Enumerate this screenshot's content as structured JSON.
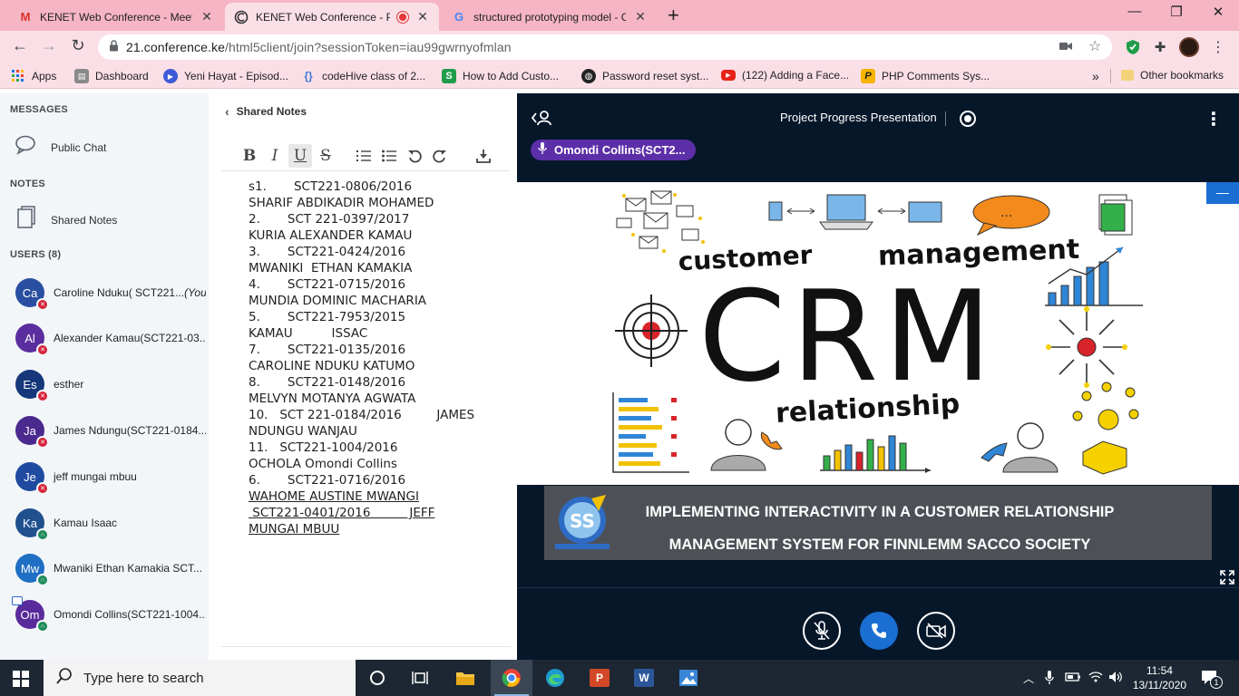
{
  "browser": {
    "tabs": [
      {
        "title": "KENET Web Conference - Meetin",
        "icon": "gmail-icon",
        "active": false
      },
      {
        "title": "KENET Web Conference - Pro",
        "icon": "conference-icon",
        "active": true
      },
      {
        "title": "structured prototyping model - C",
        "icon": "google-icon",
        "active": false
      }
    ],
    "new_tab": "+",
    "window_controls": {
      "minimize": "—",
      "restore": "❐",
      "close": "✕"
    },
    "url_host": "21.conference.ke",
    "url_path": "/html5client/join?sessionToken=iau99gwrnyofmlan",
    "bookmarks": [
      {
        "label": "Apps",
        "icon": "apps-grid-icon"
      },
      {
        "label": "Dashboard",
        "icon": "dashboard-icon"
      },
      {
        "label": "Yeni Hayat - Episod...",
        "icon": "video-icon"
      },
      {
        "label": "codeHive class of 2...",
        "icon": "codehive-icon"
      },
      {
        "label": "How to Add Custo...",
        "icon": "s-app-icon"
      },
      {
        "label": "Password reset syst...",
        "icon": "globe-icon"
      },
      {
        "label": "(122) Adding a Face...",
        "icon": "youtube-icon"
      },
      {
        "label": "PHP Comments Sys...",
        "icon": "p-app-icon"
      }
    ],
    "bookmarks_more": "»",
    "other_bookmarks": "Other bookmarks"
  },
  "sidebar": {
    "messages_label": "MESSAGES",
    "public_chat": "Public Chat",
    "notes_label": "NOTES",
    "shared_notes": "Shared Notes",
    "users_label": "USERS (8)",
    "users": [
      {
        "initials": "Ca",
        "name": "Caroline Nduku( SCT221...",
        "you": "(You)",
        "color": "#2a4fa0",
        "status": "muted"
      },
      {
        "initials": "Al",
        "name": "Alexander Kamau(SCT221-03...",
        "you": "",
        "color": "#5b2d9e",
        "status": "muted"
      },
      {
        "initials": "Es",
        "name": "esther",
        "you": "",
        "color": "#16387a",
        "status": "muted"
      },
      {
        "initials": "Ja",
        "name": "James Ndungu(SCT221-0184...",
        "you": "",
        "color": "#4a2a8e",
        "status": "muted"
      },
      {
        "initials": "Je",
        "name": "jeff mungai mbuu",
        "you": "",
        "color": "#1e4aa0",
        "status": "muted"
      },
      {
        "initials": "Ka",
        "name": "Kamau Isaac",
        "you": "",
        "color": "#21508f",
        "status": "listen"
      },
      {
        "initials": "Mw",
        "name": "Mwaniki Ethan Kamakia SCT...",
        "you": "",
        "color": "#1f6fc4",
        "status": "listen"
      },
      {
        "initials": "Om",
        "name": "Omondi Collins(SCT221-1004...",
        "you": "",
        "color": "#5a2b9b",
        "status": "listen"
      }
    ],
    "status_colors": {
      "muted": "#d6243a",
      "listen": "#1d8a5a"
    }
  },
  "notes": {
    "title": "Shared Notes",
    "toolbar": [
      "B",
      "I",
      "U",
      "S"
    ],
    "lines": [
      {
        "t": "s1.       SCT221-0806/2016",
        "u": false
      },
      {
        "t": "SHARIF ABDIKADIR MOHAMED",
        "u": false
      },
      {
        "t": "2.       SCT 221-0397/2017",
        "u": false
      },
      {
        "t": "KURIA ALEXANDER KAMAU",
        "u": false
      },
      {
        "t": "3.       SCT221-0424/2016",
        "u": false
      },
      {
        "t": "MWANIKI  ETHAN KAMAKIA",
        "u": false
      },
      {
        "t": "4.       SCT221-0715/2016",
        "u": false
      },
      {
        "t": "MUNDIA DOMINIC MACHARIA",
        "u": false
      },
      {
        "t": "5.       SCT221-7953/2015",
        "u": false
      },
      {
        "t": "KAMAU          ISSAC",
        "u": false
      },
      {
        "t": "7.       SCT221-0135/2016",
        "u": false
      },
      {
        "t": "CAROLINE NDUKU KATUMO",
        "u": false
      },
      {
        "t": "8.       SCT221-0148/2016",
        "u": false
      },
      {
        "t": "MELVYN MOTANYA AGWATA",
        "u": false
      },
      {
        "t": "10.   SCT 221-0184/2016         JAMES",
        "u": false
      },
      {
        "t": "NDUNGU WANJAU",
        "u": false
      },
      {
        "t": "11.   SCT221-1004/2016",
        "u": false
      },
      {
        "t": "OCHOLA Omondi Collins",
        "u": false
      },
      {
        "t": "6.       SCT221-0716/2016",
        "u": false
      },
      {
        "t": "WAHOME AUSTINE MWANGI",
        "u": true
      },
      {
        "t": " SCT221-0401/2016          JEFF",
        "u": true
      },
      {
        "t": "MUNGAI MBUU",
        "u": true
      }
    ]
  },
  "presentation": {
    "meeting_title": "Project Progress Presentation",
    "talker": "Omondi Collins(SCT2...",
    "minimize": "—",
    "slide_words": {
      "top_left": "customer",
      "top_right": "management",
      "center": "CRM",
      "bottom": "relationship"
    },
    "banner_line1": "IMPLEMENTING INTERACTIVITY IN A CUSTOMER RELATIONSHIP",
    "banner_line2": "MANAGEMENT SYSTEM FOR FINNLEMM SACCO SOCIETY",
    "controls": {
      "mic": "mic-muted-icon",
      "audio": "phone-icon",
      "video": "video-off-icon"
    }
  },
  "taskbar": {
    "search_placeholder": "Type here to search",
    "time": "11:54",
    "date": "13/11/2020",
    "notifications": "1"
  }
}
